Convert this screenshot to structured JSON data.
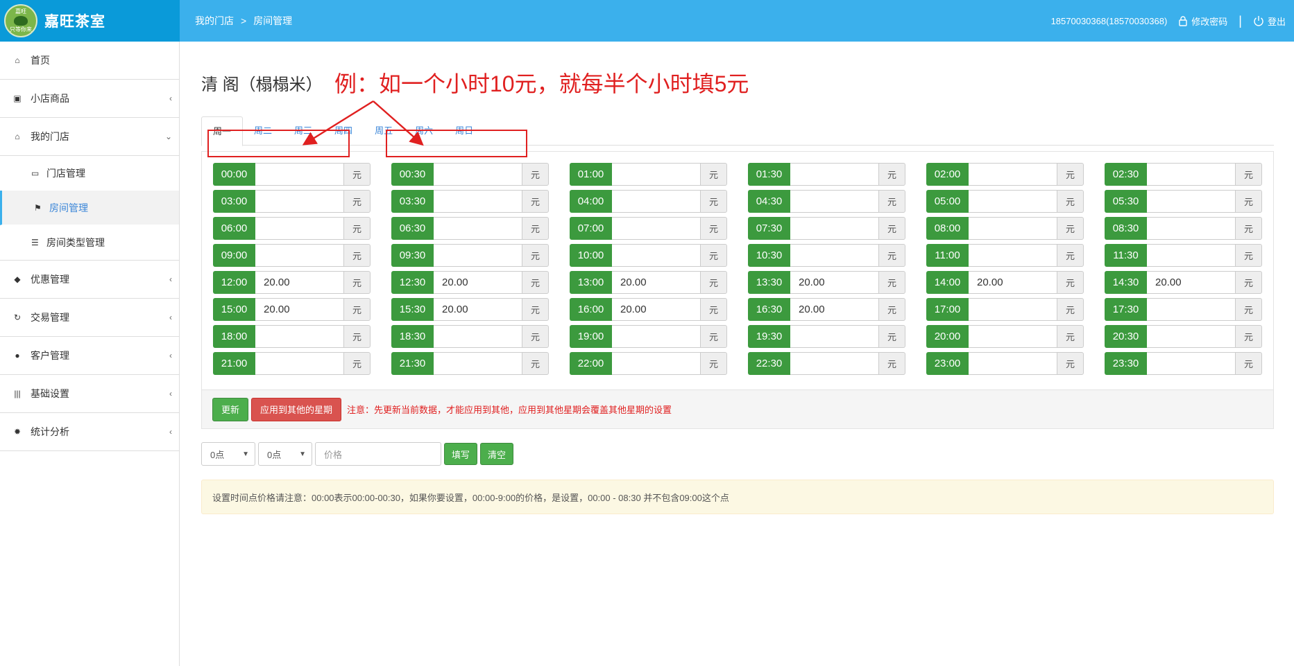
{
  "app": {
    "logo_text_top": "嘉旺",
    "logo_text_bottom": "只等你来",
    "title": "嘉旺茶室"
  },
  "header": {
    "breadcrumb": [
      "我的门店",
      "房间管理"
    ],
    "breadcrumb_sep": ">",
    "user": "18570030368(18570030368)",
    "change_password": "修改密码",
    "separator": "|",
    "logout": "登出"
  },
  "sidebar": {
    "items": [
      {
        "icon": "home-icon",
        "label": "首页",
        "chevron": ""
      },
      {
        "icon": "gift-icon",
        "label": "小店商品",
        "chevron": "‹"
      },
      {
        "icon": "home-icon",
        "label": "我的门店",
        "chevron": "⌄"
      },
      {
        "icon": "tag-icon",
        "label": "优惠管理",
        "chevron": "‹"
      },
      {
        "icon": "refresh-icon",
        "label": "交易管理",
        "chevron": "‹"
      },
      {
        "icon": "user-icon",
        "label": "客户管理",
        "chevron": "‹"
      },
      {
        "icon": "barcode-icon",
        "label": "基础设置",
        "chevron": "‹"
      },
      {
        "icon": "gear-icon",
        "label": "统计分析",
        "chevron": "‹"
      }
    ],
    "submenu": [
      {
        "icon": "inbox-icon",
        "label": "门店管理"
      },
      {
        "icon": "flag-icon",
        "label": "房间管理"
      },
      {
        "icon": "list-icon",
        "label": "房间类型管理"
      }
    ]
  },
  "page": {
    "title": "清 阁（榻榻米）",
    "annotation": "例：如一个小时10元，就每半个小时填5元"
  },
  "tabs": [
    "周一",
    "周二",
    "周三",
    "周四",
    "周五",
    "周六",
    "周日"
  ],
  "unit_label": "元",
  "slots": [
    {
      "time": "00:00",
      "value": ""
    },
    {
      "time": "00:30",
      "value": ""
    },
    {
      "time": "01:00",
      "value": ""
    },
    {
      "time": "01:30",
      "value": ""
    },
    {
      "time": "02:00",
      "value": ""
    },
    {
      "time": "02:30",
      "value": ""
    },
    {
      "time": "03:00",
      "value": ""
    },
    {
      "time": "03:30",
      "value": ""
    },
    {
      "time": "04:00",
      "value": ""
    },
    {
      "time": "04:30",
      "value": ""
    },
    {
      "time": "05:00",
      "value": ""
    },
    {
      "time": "05:30",
      "value": ""
    },
    {
      "time": "06:00",
      "value": ""
    },
    {
      "time": "06:30",
      "value": ""
    },
    {
      "time": "07:00",
      "value": ""
    },
    {
      "time": "07:30",
      "value": ""
    },
    {
      "time": "08:00",
      "value": ""
    },
    {
      "time": "08:30",
      "value": ""
    },
    {
      "time": "09:00",
      "value": ""
    },
    {
      "time": "09:30",
      "value": ""
    },
    {
      "time": "10:00",
      "value": ""
    },
    {
      "time": "10:30",
      "value": ""
    },
    {
      "time": "11:00",
      "value": ""
    },
    {
      "time": "11:30",
      "value": ""
    },
    {
      "time": "12:00",
      "value": "20.00"
    },
    {
      "time": "12:30",
      "value": "20.00"
    },
    {
      "time": "13:00",
      "value": "20.00"
    },
    {
      "time": "13:30",
      "value": "20.00"
    },
    {
      "time": "14:00",
      "value": "20.00"
    },
    {
      "time": "14:30",
      "value": "20.00"
    },
    {
      "time": "15:00",
      "value": "20.00"
    },
    {
      "time": "15:30",
      "value": "20.00"
    },
    {
      "time": "16:00",
      "value": "20.00"
    },
    {
      "time": "16:30",
      "value": "20.00"
    },
    {
      "time": "17:00",
      "value": ""
    },
    {
      "time": "17:30",
      "value": ""
    },
    {
      "time": "18:00",
      "value": ""
    },
    {
      "time": "18:30",
      "value": ""
    },
    {
      "time": "19:00",
      "value": ""
    },
    {
      "time": "19:30",
      "value": ""
    },
    {
      "time": "20:00",
      "value": ""
    },
    {
      "time": "20:30",
      "value": ""
    },
    {
      "time": "21:00",
      "value": ""
    },
    {
      "time": "21:30",
      "value": ""
    },
    {
      "time": "22:00",
      "value": ""
    },
    {
      "time": "22:30",
      "value": ""
    },
    {
      "time": "23:00",
      "value": ""
    },
    {
      "time": "23:30",
      "value": ""
    }
  ],
  "actions": {
    "update": "更新",
    "apply_other_days": "应用到其他的星期",
    "notice": "注意：先更新当前数据，才能应用到其他，应用到其他星期会覆盖其他星期的设置"
  },
  "fill": {
    "start_hour": "0点",
    "end_hour": "0点",
    "price_placeholder": "价格",
    "fill_button": "填写",
    "clear_button": "清空"
  },
  "tip": "设置时间点价格请注意：00:00表示00:00-00:30，如果你要设置，00:00-9:00的价格，是设置，00:00 - 08:30 并不包含09:00这个点",
  "colors": {
    "header_dark": "#0a9ad9",
    "header_light": "#3bb0ec",
    "slot_green": "#3c9a3e",
    "annotation_red": "#e02020"
  }
}
